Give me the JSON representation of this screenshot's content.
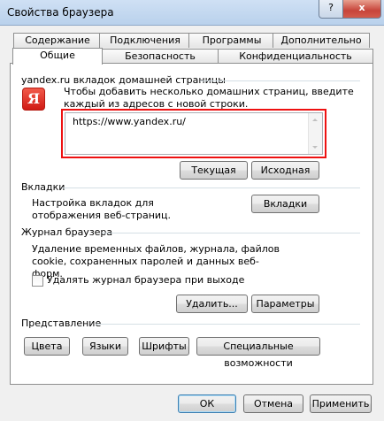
{
  "window": {
    "title": "Свойства браузера",
    "help_label": "?",
    "close_label": "x"
  },
  "tabs": {
    "row1": [
      "Содержание",
      "Подключения",
      "Программы",
      "Дополнительно"
    ],
    "row2": [
      "Общие",
      "Безопасность",
      "Конфиденциальность"
    ],
    "active": "Общие"
  },
  "home": {
    "group_label": "yandex.ru вкладок домашней страницы",
    "hint": "Чтобы добавить несколько домашних страниц, введите каждый из адресов с новой строки.",
    "logo_icon": "yandex-logo-icon",
    "logo_text": "Я",
    "url_value": "https://www.yandex.ru/",
    "current_button": "Текущая",
    "default_button": "Исходная"
  },
  "tabs_group": {
    "group_label": "Вкладки",
    "description": "Настройка вкладок для отображения веб-страниц.",
    "button": "Вкладки"
  },
  "history": {
    "group_label": "Журнал браузера",
    "description": "Удаление временных файлов, журнала, файлов cookie, сохраненных паролей и данных веб-форм.",
    "checkbox_label": "Удалять журнал браузера при выходе",
    "checkbox_checked": false,
    "delete_button": "Удалить...",
    "settings_button": "Параметры"
  },
  "appearance": {
    "group_label": "Представление",
    "buttons": [
      "Цвета",
      "Языки",
      "Шрифты",
      "Специальные возможности"
    ]
  },
  "footer": {
    "ok": "ОК",
    "cancel": "Отмена",
    "apply": "Применить"
  },
  "colors": {
    "highlight_border": "#ee1111",
    "close_button": "#c7443a"
  }
}
